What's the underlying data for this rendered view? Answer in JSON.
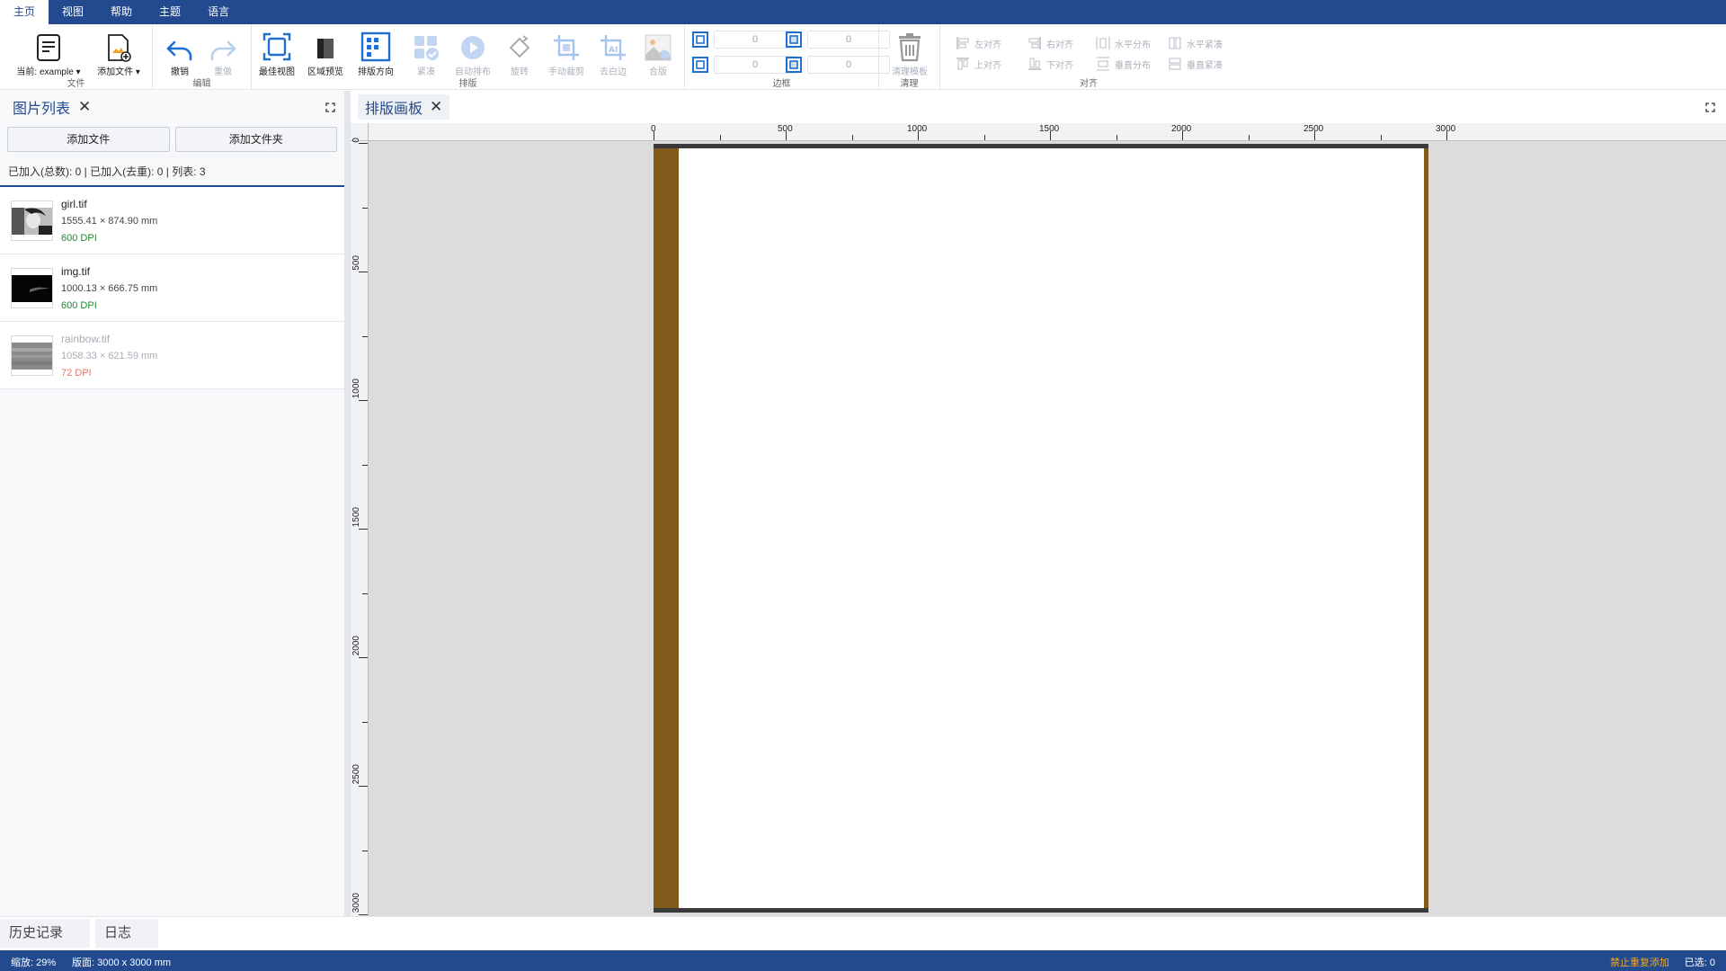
{
  "menu": {
    "items": [
      "主页",
      "视图",
      "帮助",
      "主题",
      "语言"
    ]
  },
  "ribbon": {
    "groups": {
      "file": "文件",
      "edit": "编辑",
      "layout": "排版",
      "margin": "边框",
      "clear": "清理",
      "align": "对齐"
    },
    "file": {
      "current": "当前: example ▾",
      "add_file": "添加文件 ▾"
    },
    "edit": {
      "undo": "撤销",
      "redo": "重做"
    },
    "layout": {
      "best_view": "最佳视图",
      "region_preview": "区域预览",
      "direction": "排版方向",
      "compact": "紧凑",
      "auto_layout": "自动排布",
      "rotate": "旋转",
      "manual_crop": "手动裁剪",
      "trim_white": "去白边",
      "merge": "合版"
    },
    "margin": {
      "top": "0",
      "right": "0",
      "bottom": "0",
      "left": "0"
    },
    "clear": {
      "clear_template": "清理模板"
    },
    "align": {
      "left": "左对齐",
      "top": "上对齐",
      "right": "右对齐",
      "bottom": "下对齐",
      "h_distribute": "水平分布",
      "v_distribute": "垂直分布",
      "h_compact": "水平紧凑",
      "v_compact": "垂直紧凑"
    }
  },
  "image_list": {
    "title": "图片列表",
    "close": "✕",
    "add_file": "添加文件",
    "add_folder": "添加文件夹",
    "stats": "已加入(总数): 0 | 已加入(去重): 0 | 列表: 3",
    "files": [
      {
        "name": "girl.tif",
        "size": "1555.41 × 874.90 mm",
        "dpi": "600 DPI",
        "dim": false
      },
      {
        "name": "img.tif",
        "size": "1000.13 × 666.75 mm",
        "dpi": "600 DPI",
        "dim": false
      },
      {
        "name": "rainbow.tif",
        "size": "1058.33 × 621.59 mm",
        "dpi": "72 DPI",
        "dim": true
      }
    ]
  },
  "canvas": {
    "title": "排版画板",
    "close": "✕",
    "ruler_h_labels": [
      "0",
      "500",
      "1000",
      "1500",
      "2000",
      "2500",
      "3000"
    ],
    "ruler_v_labels": [
      "0",
      "500",
      "1000",
      "1500",
      "2000",
      "2500",
      "3000"
    ],
    "sheet_width_mm": 3000,
    "sheet_height_mm": 3000,
    "frame_color": "#805a1a"
  },
  "bottom_tabs": [
    "历史记录",
    "日志"
  ],
  "status": {
    "zoom": "缩放: 29%",
    "sheet": "版面: 3000 x 3000 mm",
    "no_duplicate": "禁止重复添加",
    "selected": "已选: 0"
  },
  "colors": {
    "brand": "#234a8e",
    "accent": "#1f6fd0",
    "frame": "#805a1a",
    "ok": "#1f8a2e",
    "warn": "#e07a6a",
    "status_warn": "#f5a623"
  }
}
